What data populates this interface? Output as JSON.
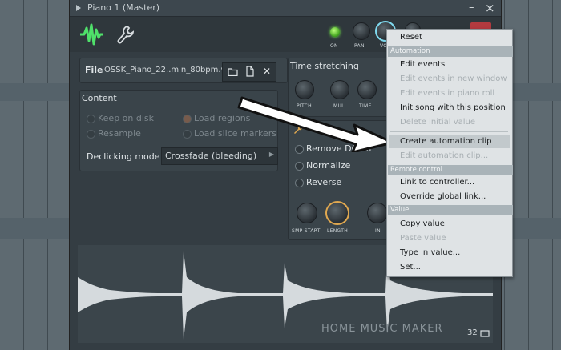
{
  "window": {
    "title": "Piano 1 (Master)",
    "minimize": "–",
    "close": "×"
  },
  "toolbar": {
    "on_label": "ON",
    "pan_label": "PAN",
    "vol_label": "VO",
    "accent": "#4fe06a"
  },
  "file": {
    "label": "File",
    "name": "OSSK_Piano_22..min_80bpm.wav",
    "close": "✕"
  },
  "content": {
    "heading": "Content",
    "keep_on_disk": "Keep on disk",
    "resample": "Resample",
    "load_regions": "Load regions",
    "load_slice_markers": "Load slice markers",
    "declicking_label": "Declicking mode",
    "declicking_value": "Crossfade (bleeding)"
  },
  "time_stretching": {
    "heading": "Time stretching",
    "pitch": "PITCH",
    "mul": "MUL",
    "time": "TIME"
  },
  "options": {
    "remove_dc": "Remove DC off",
    "normalize": "Normalize",
    "reverse": "Reverse",
    "smp_start": "SMP START",
    "length": "LENGTH",
    "in": "IN"
  },
  "waveform": {
    "bpm": "32",
    "watermark": "HOME MUSIC MAKER"
  },
  "menu": {
    "reset": "Reset",
    "sec_automation": "Automation",
    "edit_events": "Edit events",
    "edit_events_new_window": "Edit events in new window",
    "edit_events_piano_roll": "Edit events in piano roll",
    "init_song": "Init song with this position",
    "delete_initial": "Delete initial value",
    "create_clip": "Create automation clip",
    "edit_clip": "Edit automation clip...",
    "sec_remote": "Remote control",
    "link_controller": "Link to controller...",
    "override_link": "Override global link...",
    "sec_value": "Value",
    "copy_value": "Copy value",
    "paste_value": "Paste value",
    "type_in_value": "Type in value...",
    "set": "Set..."
  }
}
